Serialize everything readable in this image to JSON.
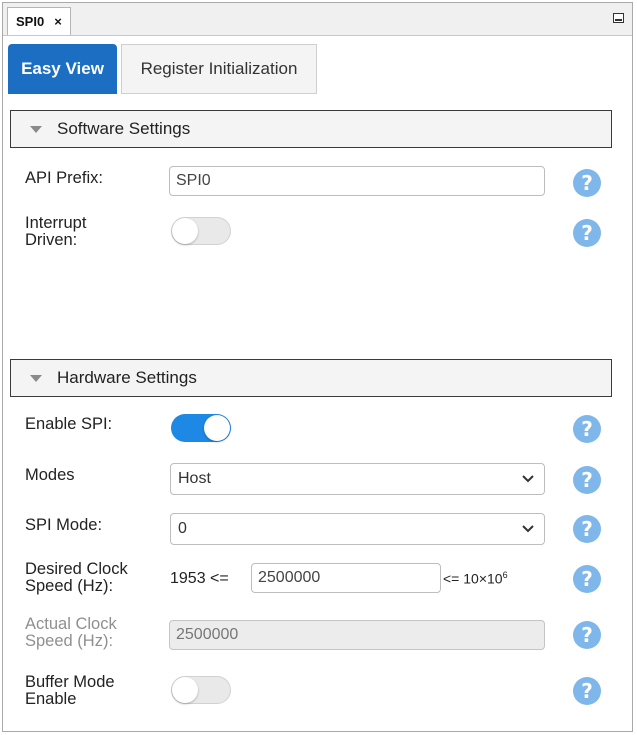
{
  "window": {
    "tab_title": "SPI0",
    "close_glyph": "×"
  },
  "tabs": [
    {
      "label": "Easy View",
      "active": true
    },
    {
      "label": "Register Initialization",
      "active": false
    }
  ],
  "software_settings": {
    "title": "Software Settings",
    "api_prefix": {
      "label": "API Prefix:",
      "value": "SPI0"
    },
    "interrupt_driven": {
      "label_line1": "Interrupt",
      "label_line2": "Driven:",
      "enabled": false
    }
  },
  "hardware_settings": {
    "title": "Hardware Settings",
    "enable_spi": {
      "label": "Enable SPI:",
      "enabled": true
    },
    "modes": {
      "label": "Modes",
      "value": "Host"
    },
    "spi_mode": {
      "label": "SPI Mode:",
      "value": "0"
    },
    "desired_clock": {
      "label_line1": "Desired Clock",
      "label_line2": "Speed (Hz):",
      "min_text": "1953",
      "le_text": "<=",
      "value": "2500000",
      "max_le_text": "<=",
      "max_text": "10×10",
      "max_exp": "6"
    },
    "actual_clock": {
      "label_line1": "Actual Clock",
      "label_line2": "Speed (Hz):",
      "value": "2500000"
    },
    "buffer_mode": {
      "label_line1": "Buffer Mode",
      "label_line2": "Enable",
      "enabled": false
    }
  },
  "help_glyph": "?",
  "icons": [
    "close-icon",
    "minimize-icon",
    "collapse-triangle-icon",
    "chevron-down-icon",
    "help-icon"
  ],
  "colors": {
    "accent": "#1b6ec2",
    "toggle_on": "#1e88e5",
    "help": "#7fb7ea"
  }
}
